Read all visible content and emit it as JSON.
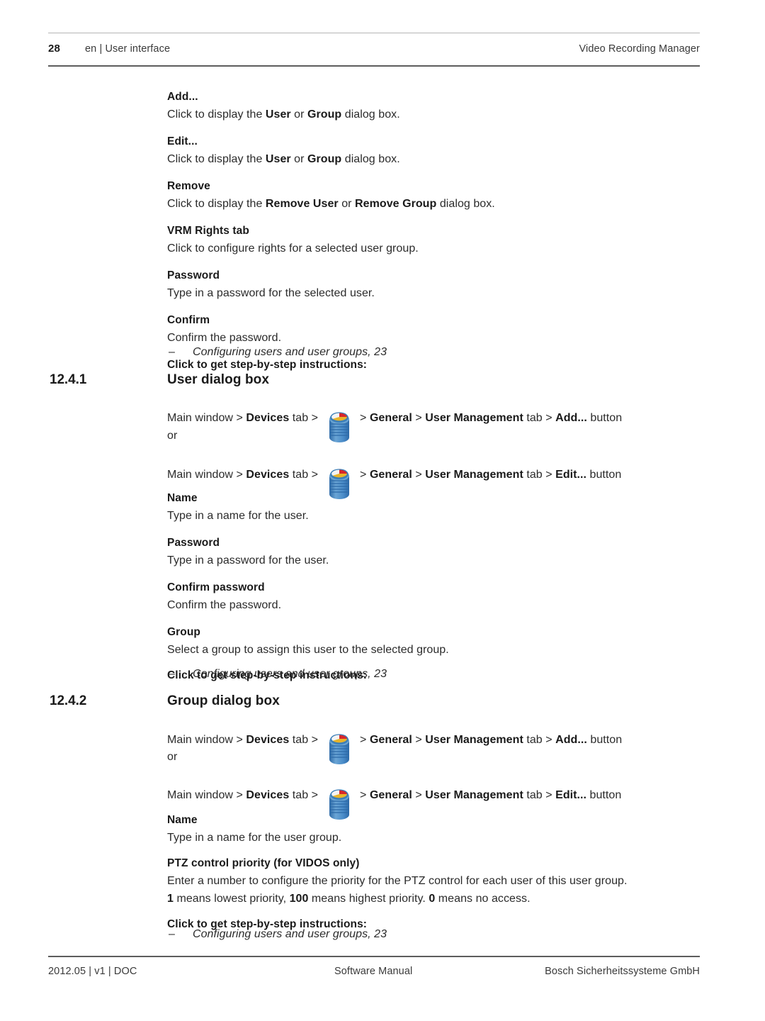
{
  "header": {
    "page_number": "28",
    "breadcrumb": "en | User interface",
    "document_title": "Video Recording Manager"
  },
  "footer": {
    "left": "2012.05 | v1 | DOC",
    "center": "Software Manual",
    "right": "Bosch Sicherheitssysteme GmbH"
  },
  "icons": {
    "vrm_device": "vrm-device-icon",
    "colors": {
      "cylinder_dark": "#2d6aa8",
      "cylinder_light": "#6aa4d4",
      "cylinder_mid": "#4a8cc9",
      "disc_white": "#f4f4f4",
      "disc_red": "#d7272b",
      "disc_yellow": "#e8b42a",
      "disc_rim": "#3d7fb8"
    }
  },
  "intro_entries": [
    {
      "term": "Add...",
      "desc_parts": [
        {
          "t": "Click to display the ",
          "b": false
        },
        {
          "t": "User",
          "b": true
        },
        {
          "t": " or ",
          "b": false
        },
        {
          "t": "Group",
          "b": true
        },
        {
          "t": " dialog box.",
          "b": false
        }
      ]
    },
    {
      "term": "Edit...",
      "desc_parts": [
        {
          "t": "Click to display the ",
          "b": false
        },
        {
          "t": "User",
          "b": true
        },
        {
          "t": " or ",
          "b": false
        },
        {
          "t": "Group",
          "b": true
        },
        {
          "t": " dialog box.",
          "b": false
        }
      ]
    },
    {
      "term": "Remove",
      "desc_parts": [
        {
          "t": "Click to display the ",
          "b": false
        },
        {
          "t": "Remove User",
          "b": true
        },
        {
          "t": " or ",
          "b": false
        },
        {
          "t": "Remove Group",
          "b": true
        },
        {
          "t": " dialog box.",
          "b": false
        }
      ]
    },
    {
      "term": "VRM Rights tab",
      "desc_parts": [
        {
          "t": "Click to configure rights for a selected user group.",
          "b": false
        }
      ]
    },
    {
      "term": "Password",
      "desc_parts": [
        {
          "t": "Type in a password for the selected user.",
          "b": false
        }
      ]
    },
    {
      "term": "Confirm",
      "desc_parts": [
        {
          "t": "Confirm the password.",
          "b": false
        }
      ]
    }
  ],
  "intro_xref": {
    "heading": "Click to get step-by-step instructions:",
    "dash": "–",
    "item": "Configuring users and user groups, 23"
  },
  "sections": [
    {
      "number": "12.4.1",
      "title": "User dialog box",
      "paths": [
        {
          "before": "Main window > ",
          "bold1": "Devices",
          "mid1": " tab > ",
          "icon": "vrm-device-icon",
          "mid2": " > ",
          "bold2": "General",
          "mid3": " > ",
          "bold3": "User Management",
          "mid4": " tab > ",
          "bold4": "Add...",
          "after": " button"
        },
        {
          "before": "Main window > ",
          "bold1": "Devices",
          "mid1": " tab > ",
          "icon": "vrm-device-icon",
          "mid2": " > ",
          "bold2": "General",
          "mid3": " > ",
          "bold3": "User Management",
          "mid4": " tab > ",
          "bold4": "Edit...",
          "after": " button"
        }
      ],
      "or_label": "or",
      "entries": [
        {
          "term": "Name",
          "desc_parts": [
            {
              "t": "Type in a name for the user.",
              "b": false
            }
          ]
        },
        {
          "term": "Password",
          "desc_parts": [
            {
              "t": "Type in a password for the user.",
              "b": false
            }
          ]
        },
        {
          "term": "Confirm password",
          "desc_parts": [
            {
              "t": "Confirm the password.",
              "b": false
            }
          ]
        },
        {
          "term": "Group",
          "desc_parts": [
            {
              "t": "Select a group to assign this user to the selected group.",
              "b": false
            }
          ]
        }
      ],
      "xref": {
        "heading": "Click to get step-by-step instructions:",
        "dash": "–",
        "item": "Configuring users and user groups, 23"
      }
    },
    {
      "number": "12.4.2",
      "title": "Group dialog box",
      "paths": [
        {
          "before": "Main window > ",
          "bold1": "Devices",
          "mid1": " tab > ",
          "icon": "vrm-device-icon",
          "mid2": " > ",
          "bold2": "General",
          "mid3": " > ",
          "bold3": "User Management",
          "mid4": " tab > ",
          "bold4": "Add...",
          "after": " button"
        },
        {
          "before": "Main window > ",
          "bold1": "Devices",
          "mid1": " tab > ",
          "icon": "vrm-device-icon",
          "mid2": " > ",
          "bold2": "General",
          "mid3": " > ",
          "bold3": "User Management",
          "mid4": " tab > ",
          "bold4": "Edit...",
          "after": " button"
        }
      ],
      "or_label": "or",
      "entries": [
        {
          "term": "Name",
          "desc_parts": [
            {
              "t": "Type in a name for the user group.",
              "b": false
            }
          ]
        },
        {
          "term": "PTZ control priority (for VIDOS only)",
          "desc_parts": [
            {
              "t": "Enter a number to configure the priority for the PTZ control for each user of this user group.",
              "b": false
            }
          ]
        }
      ],
      "priority_note": [
        {
          "t": "1",
          "b": true
        },
        {
          "t": " means lowest priority, ",
          "b": false
        },
        {
          "t": "100",
          "b": true
        },
        {
          "t": " means highest priority. ",
          "b": false
        },
        {
          "t": "0",
          "b": true
        },
        {
          "t": " means no access.",
          "b": false
        }
      ],
      "xref": {
        "heading": "Click to get step-by-step instructions:",
        "dash": "–",
        "item": "Configuring users and user groups, 23"
      }
    }
  ]
}
